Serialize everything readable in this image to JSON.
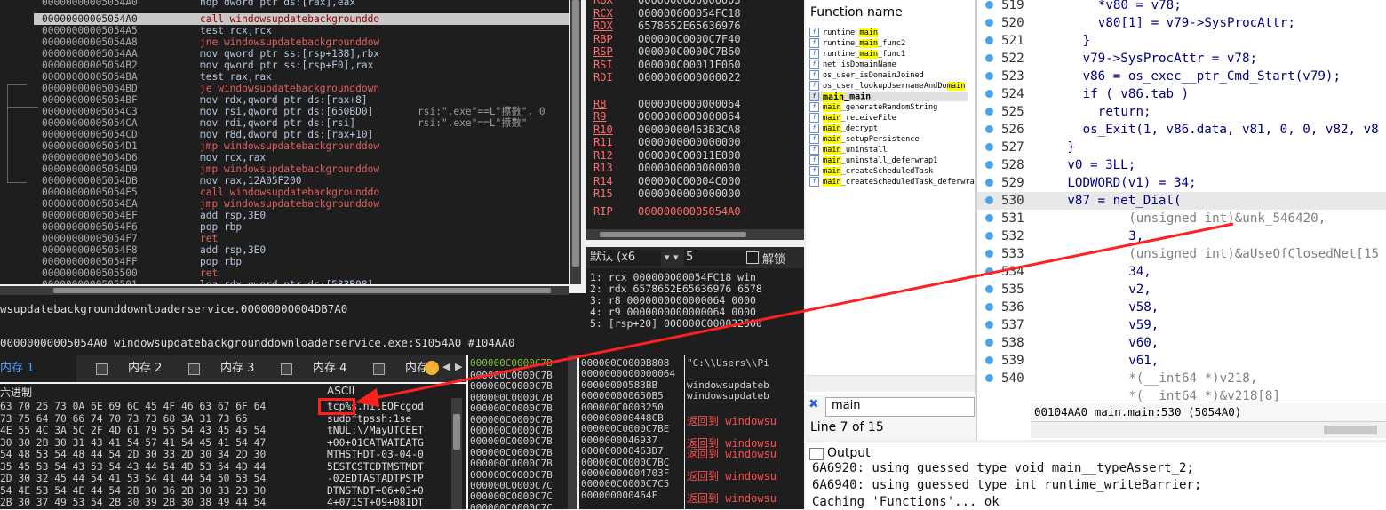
{
  "disasm": {
    "rows": [
      {
        "addr": "00000000005054A0",
        "ins": "nop dword ptr ds:[rax],eax",
        "type": "plain",
        "comment": ""
      },
      {
        "addr": "00000000005054A0",
        "ins": "call windowsupdatebackgrounddo",
        "type": "call",
        "comment": "",
        "current": true
      },
      {
        "addr": "00000000005054A5",
        "ins": "test rcx,rcx",
        "type": "plain",
        "comment": ""
      },
      {
        "addr": "00000000005054A8",
        "ins": "jne windowsupdatebackgrounddow",
        "type": "jmp",
        "comment": ""
      },
      {
        "addr": "00000000005054AA",
        "ins": "mov qword ptr ss:[rsp+188],rbx",
        "type": "plain",
        "comment": ""
      },
      {
        "addr": "00000000005054B2",
        "ins": "mov qword ptr ss:[rsp+F0],rax",
        "type": "plain",
        "comment": ""
      },
      {
        "addr": "00000000005054BA",
        "ins": "test rax,rax",
        "type": "plain",
        "comment": ""
      },
      {
        "addr": "00000000005054BD",
        "ins": "je windowsupdatebackgrounddown",
        "type": "jmp",
        "comment": ""
      },
      {
        "addr": "00000000005054BF",
        "ins": "mov rdx,qword ptr ds:[rax+8]",
        "type": "plain",
        "comment": ""
      },
      {
        "addr": "00000000005054C3",
        "ins": "mov rsi,qword ptr ds:[650BD0]",
        "type": "plain",
        "comment": "rsi:\".exe\"==L\"攃數\", 0"
      },
      {
        "addr": "00000000005054CA",
        "ins": "mov rdi,qword ptr ds:[rsi]",
        "type": "plain",
        "comment": "rsi:\".exe\"==L\"攃數\""
      },
      {
        "addr": "00000000005054CD",
        "ins": "mov r8d,dword ptr ds:[rax+10]",
        "type": "plain",
        "comment": ""
      },
      {
        "addr": "00000000005054D1",
        "ins": "jmp windowsupdatebackgrounddow",
        "type": "jmp",
        "comment": ""
      },
      {
        "addr": "00000000005054D6",
        "ins": "mov rcx,rax",
        "type": "plain",
        "comment": ""
      },
      {
        "addr": "00000000005054D9",
        "ins": "jmp windowsupdatebackgrounddow",
        "type": "jmp",
        "comment": ""
      },
      {
        "addr": "00000000005054DB",
        "ins": "mov rax,12A05F200",
        "type": "plain",
        "comment": ""
      },
      {
        "addr": "00000000005054E5",
        "ins": "call windowsupdatebackgrounddo",
        "type": "call",
        "comment": ""
      },
      {
        "addr": "00000000005054EA",
        "ins": "jmp windowsupdatebackgrounddow",
        "type": "jmp",
        "comment": ""
      },
      {
        "addr": "00000000005054EF",
        "ins": "add rsp,3E0",
        "type": "plain",
        "comment": ""
      },
      {
        "addr": "00000000005054F6",
        "ins": "pop rbp",
        "type": "plain",
        "comment": ""
      },
      {
        "addr": "00000000005054F7",
        "ins": "ret",
        "type": "call",
        "comment": ""
      },
      {
        "addr": "00000000005054F8",
        "ins": "add rsp,3E0",
        "type": "plain",
        "comment": ""
      },
      {
        "addr": "00000000005054FF",
        "ins": "pop rbp",
        "type": "plain",
        "comment": ""
      },
      {
        "addr": "0000000000505500",
        "ins": "ret",
        "type": "call",
        "comment": ""
      },
      {
        "addr": "0000000000505501",
        "ins": "lea rdx,qword ptr ds:[583B98]",
        "type": "plain",
        "comment": ""
      }
    ]
  },
  "registers": [
    {
      "name": "RBX",
      "value": "0000000000000003"
    },
    {
      "name": "RCX",
      "value": "000000000054FC18"
    },
    {
      "name": "RDX",
      "value": "6578652E65636976"
    },
    {
      "name": "RBP",
      "value": "000000C0000C7F40"
    },
    {
      "name": "RSP",
      "value": "000000C0000C7B60"
    },
    {
      "name": "RSI",
      "value": "000000C00011E060"
    },
    {
      "name": "RDI",
      "value": "0000000000000022"
    },
    {
      "name": "R8",
      "value": "0000000000000064"
    },
    {
      "name": "R9",
      "value": "0000000000000064"
    },
    {
      "name": "R10",
      "value": "00000000463B3CA8"
    },
    {
      "name": "R11",
      "value": "0000000000000000"
    },
    {
      "name": "R12",
      "value": "000000C00011E000"
    },
    {
      "name": "R13",
      "value": "0000000000000000"
    },
    {
      "name": "R14",
      "value": "000000C00004C000"
    },
    {
      "name": "R15",
      "value": "0000000000000000"
    },
    {
      "name": "RIP",
      "value": "00000000005054A0"
    }
  ],
  "callconv": {
    "convention": "默认 (x6",
    "count": "5",
    "unlock_label": "解锁",
    "rows": [
      "1: rcx 000000000054FC18 win",
      "2: rdx 6578652E65636976 6578",
      "3: r8 0000000000000064 0000",
      "4: r9 0000000000000064 0000",
      "5: [rsp+20] 000000C000032500"
    ]
  },
  "status": {
    "line1": "wsupdatebackgrounddownloaderservice.00000000004DB7A0",
    "line2": "00000000005054A0 windowsupdatebackgrounddownloaderservice.exe:$1054A0 #104AA0"
  },
  "memtabs": [
    "内存 1",
    "内存 2",
    "内存 3",
    "内存 4",
    "内存 5"
  ],
  "hex": {
    "header_left": "六进制",
    "header_right": "ASCII",
    "rows": [
      {
        "bytes": "63 70 25 73 0A 6E 69 6C 45 4F 46 63 67 6F 64",
        "ascii": "tcp%s.nilEOFcgod"
      },
      {
        "bytes": "73 75 64 70 66 74 70 73 73 68 3A 31 73 65",
        "ascii": "sudpftpssh:1se"
      },
      {
        "bytes": "4E 55 4C 3A 5C 2F 4D 61 79 55 54 43 45 45 54",
        "ascii": "tNUL:\\/MayUTCEET"
      },
      {
        "bytes": "30 30 2B 30 31 43 41 54 57 41 54 45 41 54 47",
        "ascii": "+00+01CATWATEATG"
      },
      {
        "bytes": "54 48 53 54 48 44 54 2D 30 33 2D 30 34 2D 30",
        "ascii": "MTHSTHDT-03-04-0"
      },
      {
        "bytes": "35 45 53 54 43 53 54 43 44 54 4D 53 54 4D 44",
        "ascii": "5ESTCSTCDTMSTMDT"
      },
      {
        "bytes": "2D 30 32 45 44 54 41 53 54 41 44 54 50 53 54",
        "ascii": "-02EDTASTADTPSTP"
      },
      {
        "bytes": "54 4E 53 54 4E 44 54 2B 30 36 2B 30 33 2B 30",
        "ascii": "DTNSTNDT+06+03+0"
      },
      {
        "bytes": "2B 30 37 49 53 54 2B 30 39 2B 30 38 49 44 54",
        "ascii": "4+07IST+09+08IDT"
      }
    ]
  },
  "stack": {
    "addr_header": "000000C0000C7B",
    "addrs": [
      "000000C0000C7B",
      "000000C0000C7B",
      "000000C0000C7B",
      "000000C0000C7B",
      "000000C0000C7B",
      "000000C0000C7B",
      "000000C0000C7B",
      "000000C0000C7B",
      "000000C0000C7B",
      "000000C0000C7B",
      "000000C0000C7C",
      "000000C0000C7C",
      "000000C0000C7C"
    ],
    "vals": [
      "000000C0000B808",
      "0000000000000064",
      "00000000583BB",
      "000000000650B5",
      "000000C0003250",
      "000000000448CB",
      "000000C0000C7BE",
      "0000000046937",
      "000000000463D7",
      "000000C0000C7BC",
      "00000000004703F",
      "000000C0000C7C5",
      "000000000464F"
    ],
    "coms": [
      {
        "text": "\"C:\\\\Users\\\\Pi",
        "ret": false
      },
      {
        "text": "",
        "ret": false
      },
      {
        "text": "windowsupdateb",
        "ret": false
      },
      {
        "text": "windowsupdateb",
        "ret": false
      },
      {
        "text": "",
        "ret": false
      },
      {
        "text": "返回到 windowsu",
        "ret": true
      },
      {
        "text": "",
        "ret": false
      },
      {
        "text": "返回到 windowsu",
        "ret": true
      },
      {
        "text": "返回到 windowsu",
        "ret": true
      },
      {
        "text": "",
        "ret": false
      },
      {
        "text": "返回到 windowsu",
        "ret": true
      },
      {
        "text": "",
        "ret": false
      },
      {
        "text": "返回到 windowsu",
        "ret": true
      }
    ]
  },
  "functions": {
    "header": "Function name",
    "items": [
      {
        "pre": "runtime_",
        "hl": "main",
        "post": ""
      },
      {
        "pre": "runtime_",
        "hl": "main",
        "post": "_func2"
      },
      {
        "pre": "runtime_",
        "hl": "main",
        "post": "_func1"
      },
      {
        "pre": "net_isDomainName",
        "hl": "",
        "post": ""
      },
      {
        "pre": "os_user_isDomainJoined",
        "hl": "",
        "post": ""
      },
      {
        "pre": "os_user_lookupUsernameAndDo",
        "hl": "main",
        "post": ""
      },
      {
        "pre": "",
        "hl": "main",
        "post": "_main",
        "bold": true
      },
      {
        "pre": "",
        "hl": "main",
        "post": "_generateRandomString"
      },
      {
        "pre": "",
        "hl": "main",
        "post": "_receiveFile"
      },
      {
        "pre": "",
        "hl": "main",
        "post": "_decrypt"
      },
      {
        "pre": "",
        "hl": "main",
        "post": "_setupPersistence"
      },
      {
        "pre": "",
        "hl": "main",
        "post": "_uninstall"
      },
      {
        "pre": "",
        "hl": "main",
        "post": "_uninstall_deferwrap1"
      },
      {
        "pre": "",
        "hl": "main",
        "post": "_createScheduledTask"
      },
      {
        "pre": "",
        "hl": "main",
        "post": "_createScheduledTask_deferwra"
      }
    ],
    "search_value": "main",
    "line_status": "Line 7 of 15"
  },
  "pseudocode": {
    "rows": [
      {
        "num": "519",
        "code": "        *v80 = v78;"
      },
      {
        "num": "520",
        "code": "        v80[1] = v79->SysProcAttr;"
      },
      {
        "num": "521",
        "code": "      }"
      },
      {
        "num": "522",
        "code": "      v79->SysProcAttr = v78;"
      },
      {
        "num": "523",
        "code": "      v86 = os_exec__ptr_Cmd_Start(v79);"
      },
      {
        "num": "524",
        "code": "      if ( v86.tab )"
      },
      {
        "num": "525",
        "code": "        return;"
      },
      {
        "num": "526",
        "code": "      os_Exit(1, v86.data, v81, 0, 0, v82, v8"
      },
      {
        "num": "527",
        "code": "    }"
      },
      {
        "num": "528",
        "code": "    v0 = 3LL;"
      },
      {
        "num": "529",
        "code": "    LODWORD(v1) = 34;"
      },
      {
        "num": "530",
        "code": "    v87 = net_Dial(",
        "current": true
      },
      {
        "num": "531",
        "code": "            (unsigned int)&unk_546420,"
      },
      {
        "num": "532",
        "code": "            3,"
      },
      {
        "num": "533",
        "code": "            (unsigned int)&aUseOfClosedNet[15"
      },
      {
        "num": "534",
        "code": "            34,"
      },
      {
        "num": "535",
        "code": "            v2,"
      },
      {
        "num": "536",
        "code": "            v58,"
      },
      {
        "num": "537",
        "code": "            v59,"
      },
      {
        "num": "538",
        "code": "            v60,"
      },
      {
        "num": "539",
        "code": "            v61,"
      },
      {
        "num": "540",
        "code": "            *(__int64 *)v218,"
      },
      {
        "num": "",
        "code": "            *(__int64 *)&v218[8]"
      }
    ],
    "status": "00104AA0 main.main:530 (5054A0)"
  },
  "output": {
    "title": "Output",
    "lines": [
      "6A6920: using guessed type void  main__typeAssert_2;",
      "6A6940: using guessed type int runtime_writeBarrier;",
      "Caching 'Functions'... ok"
    ]
  },
  "colors": {
    "annotation": "#ff2020"
  }
}
